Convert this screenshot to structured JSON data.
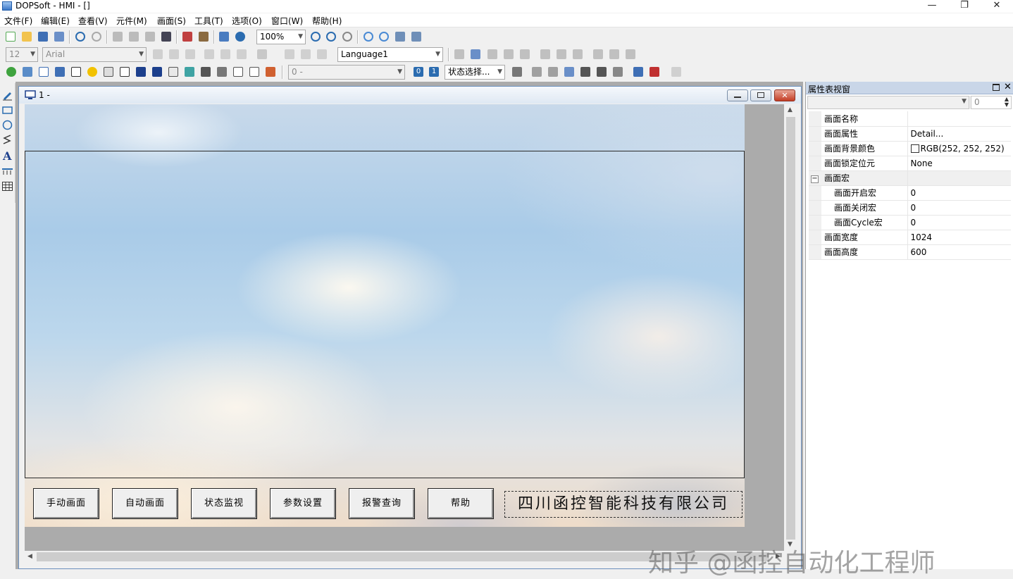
{
  "window": {
    "title": "DOPSoft - HMI - []"
  },
  "window_controls": {
    "minimize": "—",
    "restore": "❐",
    "close": "✕"
  },
  "menu": [
    "文件(F)",
    "编辑(E)",
    "查看(V)",
    "元件(M)",
    "画面(S)",
    "工具(T)",
    "选项(O)",
    "窗口(W)",
    "帮助(H)"
  ],
  "toolbar": {
    "zoom": "100%",
    "font_size": "12",
    "font_name": "Arial",
    "language": "Language1",
    "state_value": "0 -",
    "state_select": "状态选择...",
    "badge_0": "0",
    "badge_1": "1"
  },
  "editor": {
    "tab_title": "1 -",
    "screen_buttons": [
      "手动画面",
      "自动画面",
      "状态监视",
      "参数设置",
      "报警查询",
      "帮助"
    ],
    "company_text": "四川函控智能科技有限公司"
  },
  "properties": {
    "title": "属性表视窗",
    "object_index": "0",
    "rows": [
      {
        "key": "画面名称",
        "value": ""
      },
      {
        "key": "画面属性",
        "value": "Detail..."
      },
      {
        "key": "画面背景颜色",
        "value": "RGB(252, 252, 252)"
      },
      {
        "key": "画面锁定位元",
        "value": "None"
      },
      {
        "key": "画面宏",
        "value": "",
        "group": true
      },
      {
        "key": "画面开启宏",
        "value": "0",
        "sub": true
      },
      {
        "key": "画面关闭宏",
        "value": "0",
        "sub": true
      },
      {
        "key": "画面Cycle宏",
        "value": "0",
        "sub": true
      },
      {
        "key": "画面宽度",
        "value": "1024"
      },
      {
        "key": "画面高度",
        "value": "600"
      }
    ]
  },
  "colors": {
    "accent": "#2b6cb0",
    "panel_header": "#c9d6e8",
    "canvas_bg": "#ababab"
  },
  "watermark": "知乎 @函控自动化工程师"
}
